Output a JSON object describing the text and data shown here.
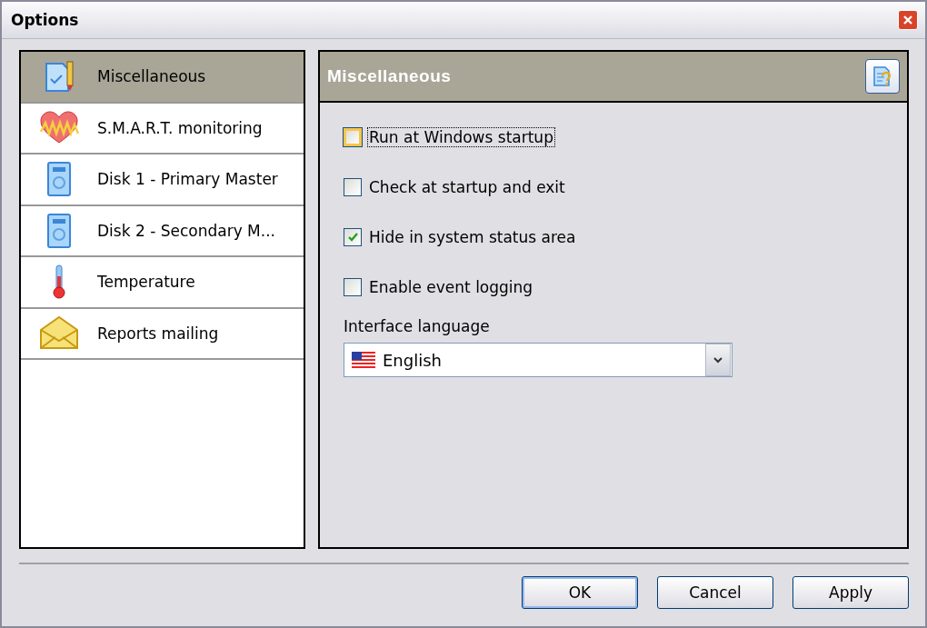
{
  "window": {
    "title": "Options"
  },
  "sidebar": {
    "items": [
      {
        "label": "Miscellaneous",
        "kind": "misc",
        "selected": true
      },
      {
        "label": "S.M.A.R.T. monitoring",
        "kind": "heart",
        "selected": false
      },
      {
        "label": "Disk 1 - Primary Master",
        "kind": "disk",
        "selected": false
      },
      {
        "label": "Disk 2 - Secondary M...",
        "kind": "disk",
        "selected": false
      },
      {
        "label": "Temperature",
        "kind": "thermometer",
        "selected": false
      },
      {
        "label": "Reports mailing",
        "kind": "envelope",
        "selected": false
      }
    ]
  },
  "panel": {
    "title": "Miscellaneous",
    "options": [
      {
        "label": "Run at Windows startup",
        "checked": false,
        "focused": true
      },
      {
        "label": "Check at startup and exit",
        "checked": false,
        "focused": false
      },
      {
        "label": "Hide in system status area",
        "checked": true,
        "focused": false
      },
      {
        "label": "Enable event logging",
        "checked": false,
        "focused": false
      }
    ],
    "language": {
      "label": "Interface language",
      "value": "English"
    }
  },
  "buttons": [
    {
      "label": "OK",
      "default": true
    },
    {
      "label": "Cancel",
      "default": false
    },
    {
      "label": "Apply",
      "default": false
    }
  ]
}
